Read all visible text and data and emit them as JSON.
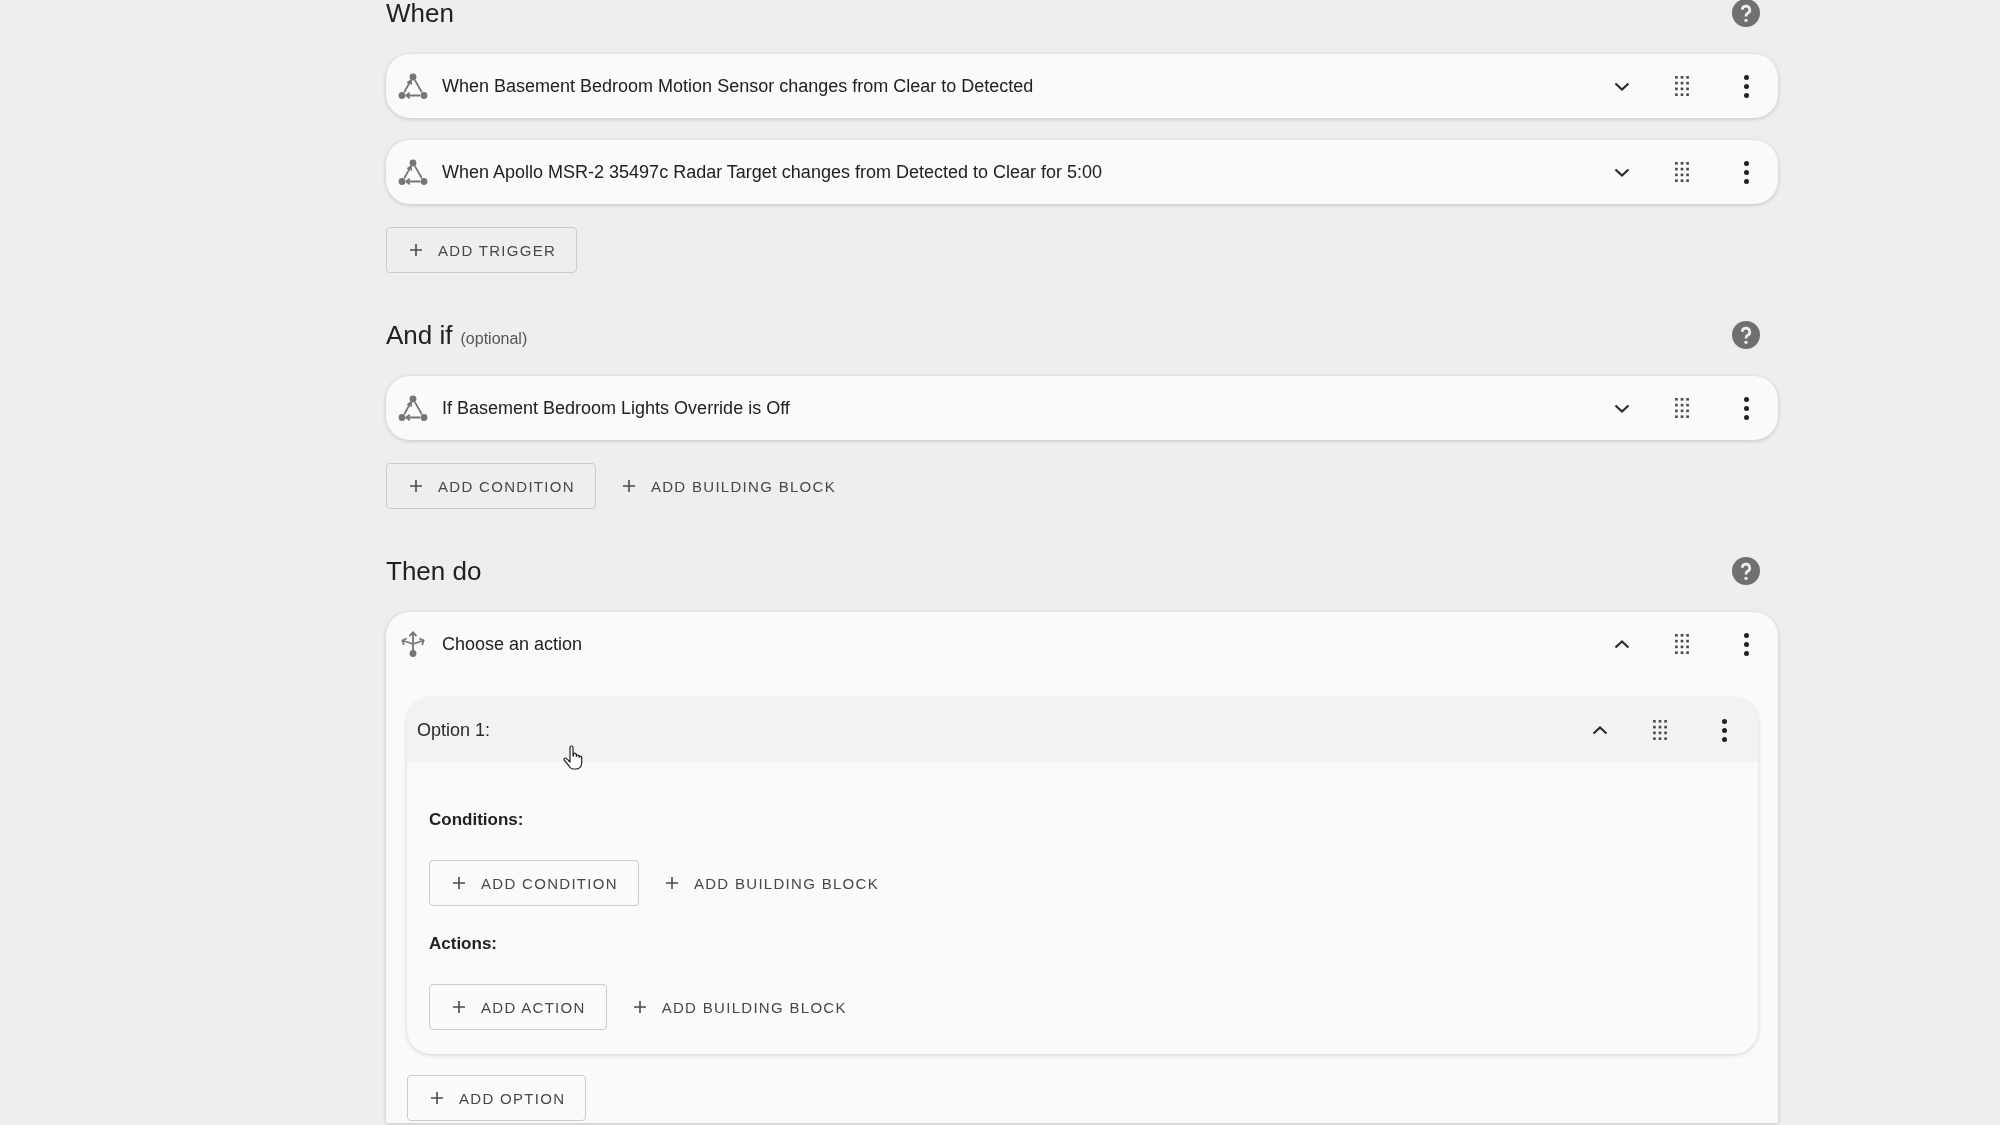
{
  "sections": [
    {
      "title": "When",
      "items": [
        {
          "kind": "state",
          "text": "When Basement Bedroom Motion Sensor changes from Clear to Detected",
          "expanded": false
        },
        {
          "kind": "state",
          "text": "When Apollo MSR-2 35497c Radar Target changes from Detected to Clear for 5:00",
          "expanded": false
        }
      ],
      "buttons": [
        {
          "kind": "outlined",
          "label": "ADD TRIGGER"
        }
      ]
    },
    {
      "title": "And if",
      "note": "(optional)",
      "items": [
        {
          "kind": "state",
          "text": "If Basement Bedroom Lights Override is Off",
          "expanded": false
        }
      ],
      "buttons": [
        {
          "kind": "outlined",
          "label": "ADD CONDITION"
        },
        {
          "kind": "text",
          "label": "ADD BUILDING BLOCK"
        }
      ]
    },
    {
      "title": "Then do",
      "items": [
        {
          "kind": "choose",
          "text": "Choose an action",
          "expanded": true,
          "options": [
            {
              "title": "Option 1:",
              "expanded": true,
              "groups": [
                {
                  "label": "Conditions:",
                  "buttons": [
                    {
                      "kind": "outlined",
                      "label": "ADD CONDITION"
                    },
                    {
                      "kind": "text",
                      "label": "ADD BUILDING BLOCK"
                    }
                  ]
                },
                {
                  "label": "Actions:",
                  "buttons": [
                    {
                      "kind": "outlined",
                      "label": "ADD ACTION"
                    },
                    {
                      "kind": "text",
                      "label": "ADD BUILDING BLOCK"
                    }
                  ]
                }
              ]
            }
          ],
          "buttons": [
            {
              "kind": "outlined",
              "label": "ADD OPTION"
            }
          ]
        }
      ]
    }
  ]
}
